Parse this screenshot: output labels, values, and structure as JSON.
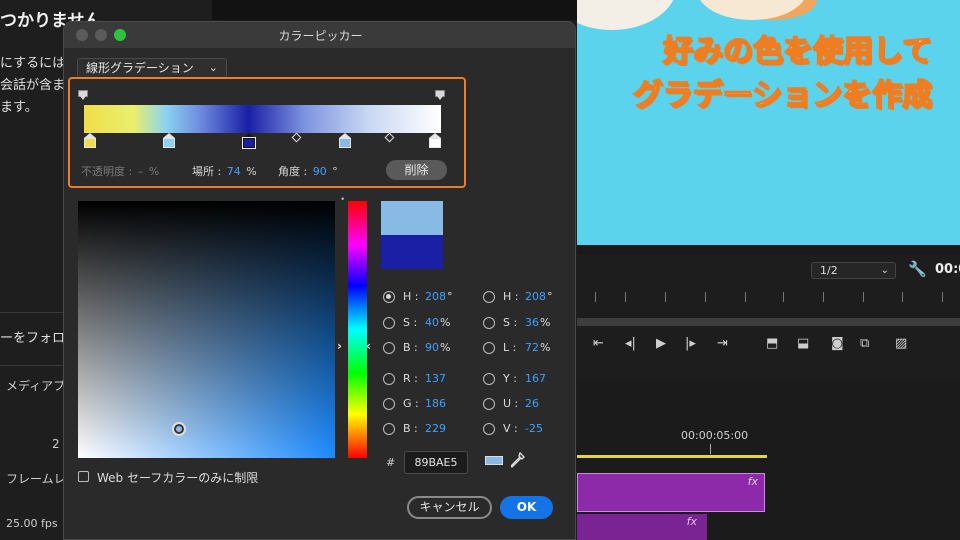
{
  "background": {
    "left_panel": {
      "heading": "つかりません",
      "lines": [
        "にするには",
        "会話が含ま",
        "ます。"
      ],
      "follow_text": "ーをフォロ",
      "media_label": "メディアプ",
      "frame_label": "フレームレ",
      "fps_value": "25.00 fps",
      "side_number": "2"
    },
    "preview": {
      "caption_line1": "好みの色を使用して",
      "caption_line2": "グラデーションを作成",
      "caption_stroke_color": "#ef7d22",
      "background_color": "#5bd3ec"
    },
    "program_monitor": {
      "zoom_value": "1/2",
      "timecode": "00:0"
    },
    "timeline": {
      "time_label": "00:00:05:00",
      "fx_label": "fx",
      "clip_color": "#8d2aa9"
    }
  },
  "dialog": {
    "title": "カラーピッカー",
    "gradient_type": "線形グラデーション",
    "gradient": {
      "opacity_label": "不透明度 :",
      "opacity_value": "–",
      "opacity_unit": "%",
      "location_label": "場所 :",
      "location_value": "74",
      "location_unit": "%",
      "angle_label": "角度 :",
      "angle_value": "90",
      "angle_unit": "°",
      "delete_label": "削除",
      "color_stops": [
        {
          "color": "#f0de48",
          "position": 0.0
        },
        {
          "color": "#8bd2f2",
          "position": 0.23
        },
        {
          "color": "#1a1fa6",
          "position": 0.46,
          "selected": true
        },
        {
          "color": "#89bae5",
          "position": 0.74
        },
        {
          "color": "#ffffff",
          "position": 1.0
        }
      ],
      "highlight_color": "#ef7d22"
    },
    "new_color": "#89bae5",
    "old_color": "#1a1fa6",
    "hsb": {
      "h": {
        "label": "H :",
        "value": "208",
        "unit": "°"
      },
      "s": {
        "label": "S :",
        "value": "40",
        "unit": "%"
      },
      "b": {
        "label": "B :",
        "value": "90",
        "unit": "%"
      }
    },
    "hsl": {
      "h": {
        "label": "H :",
        "value": "208",
        "unit": "°"
      },
      "s": {
        "label": "S :",
        "value": "36",
        "unit": "%"
      },
      "l": {
        "label": "L :",
        "value": "72",
        "unit": "%"
      }
    },
    "rgb": {
      "r": {
        "label": "R :",
        "value": "137"
      },
      "g": {
        "label": "G :",
        "value": "186"
      },
      "b": {
        "label": "B :",
        "value": "229"
      }
    },
    "yuv": {
      "y": {
        "label": "Y :",
        "value": "167"
      },
      "u": {
        "label": "U :",
        "value": "26"
      },
      "v": {
        "label": "V :",
        "value": "-25"
      }
    },
    "hex_prefix": "#",
    "hex_value": "89BAE5",
    "websafe_label": "Web セーフカラーのみに制限",
    "cancel_label": "キャンセル",
    "ok_label": "OK",
    "accent_color": "#1473e6",
    "value_color": "#3ea0ff"
  }
}
